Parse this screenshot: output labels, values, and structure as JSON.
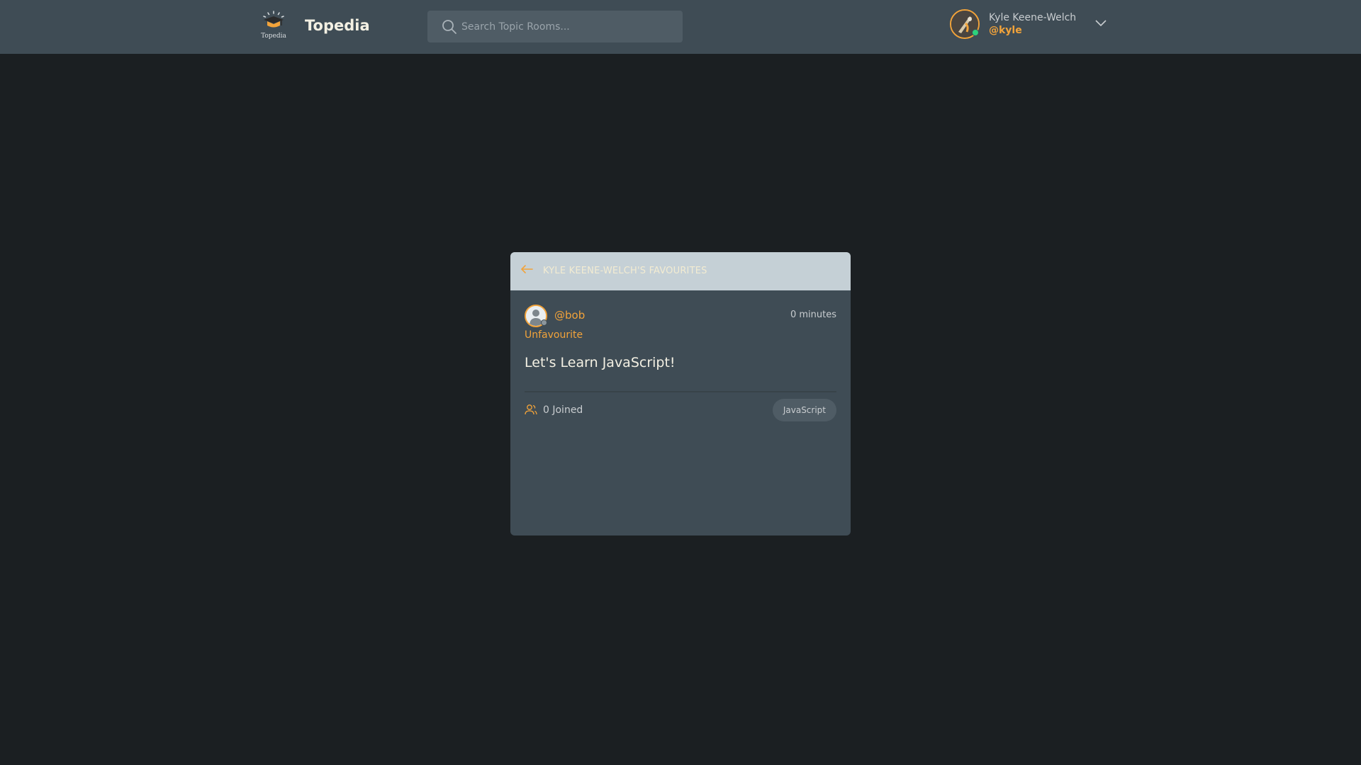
{
  "app": {
    "logo_caption": "Topedia",
    "brand": "Topedia"
  },
  "search": {
    "placeholder": "Search Topic Rooms..."
  },
  "user": {
    "name": "Kyle Keene-Welch",
    "handle": "@kyle",
    "status": "online"
  },
  "favourites": {
    "title": "KYLE KEENE-WELCH'S FAVOURITES",
    "rooms": [
      {
        "host_handle": "@bob",
        "time": "0 minutes",
        "action": "Unfavourite",
        "name": "Let's Learn JavaScript!",
        "joined": "0 Joined",
        "topic": "JavaScript"
      }
    ]
  },
  "icons": {
    "search": "search-icon",
    "chevron": "chevron-down-icon",
    "back": "arrow-left-icon",
    "people": "users-icon"
  },
  "colors": {
    "accent": "#f2a33a",
    "header_bg": "#3f4c55",
    "page_bg": "#1b1f22",
    "card_head_bg": "#c5d0d6",
    "online": "#2dd17c"
  }
}
